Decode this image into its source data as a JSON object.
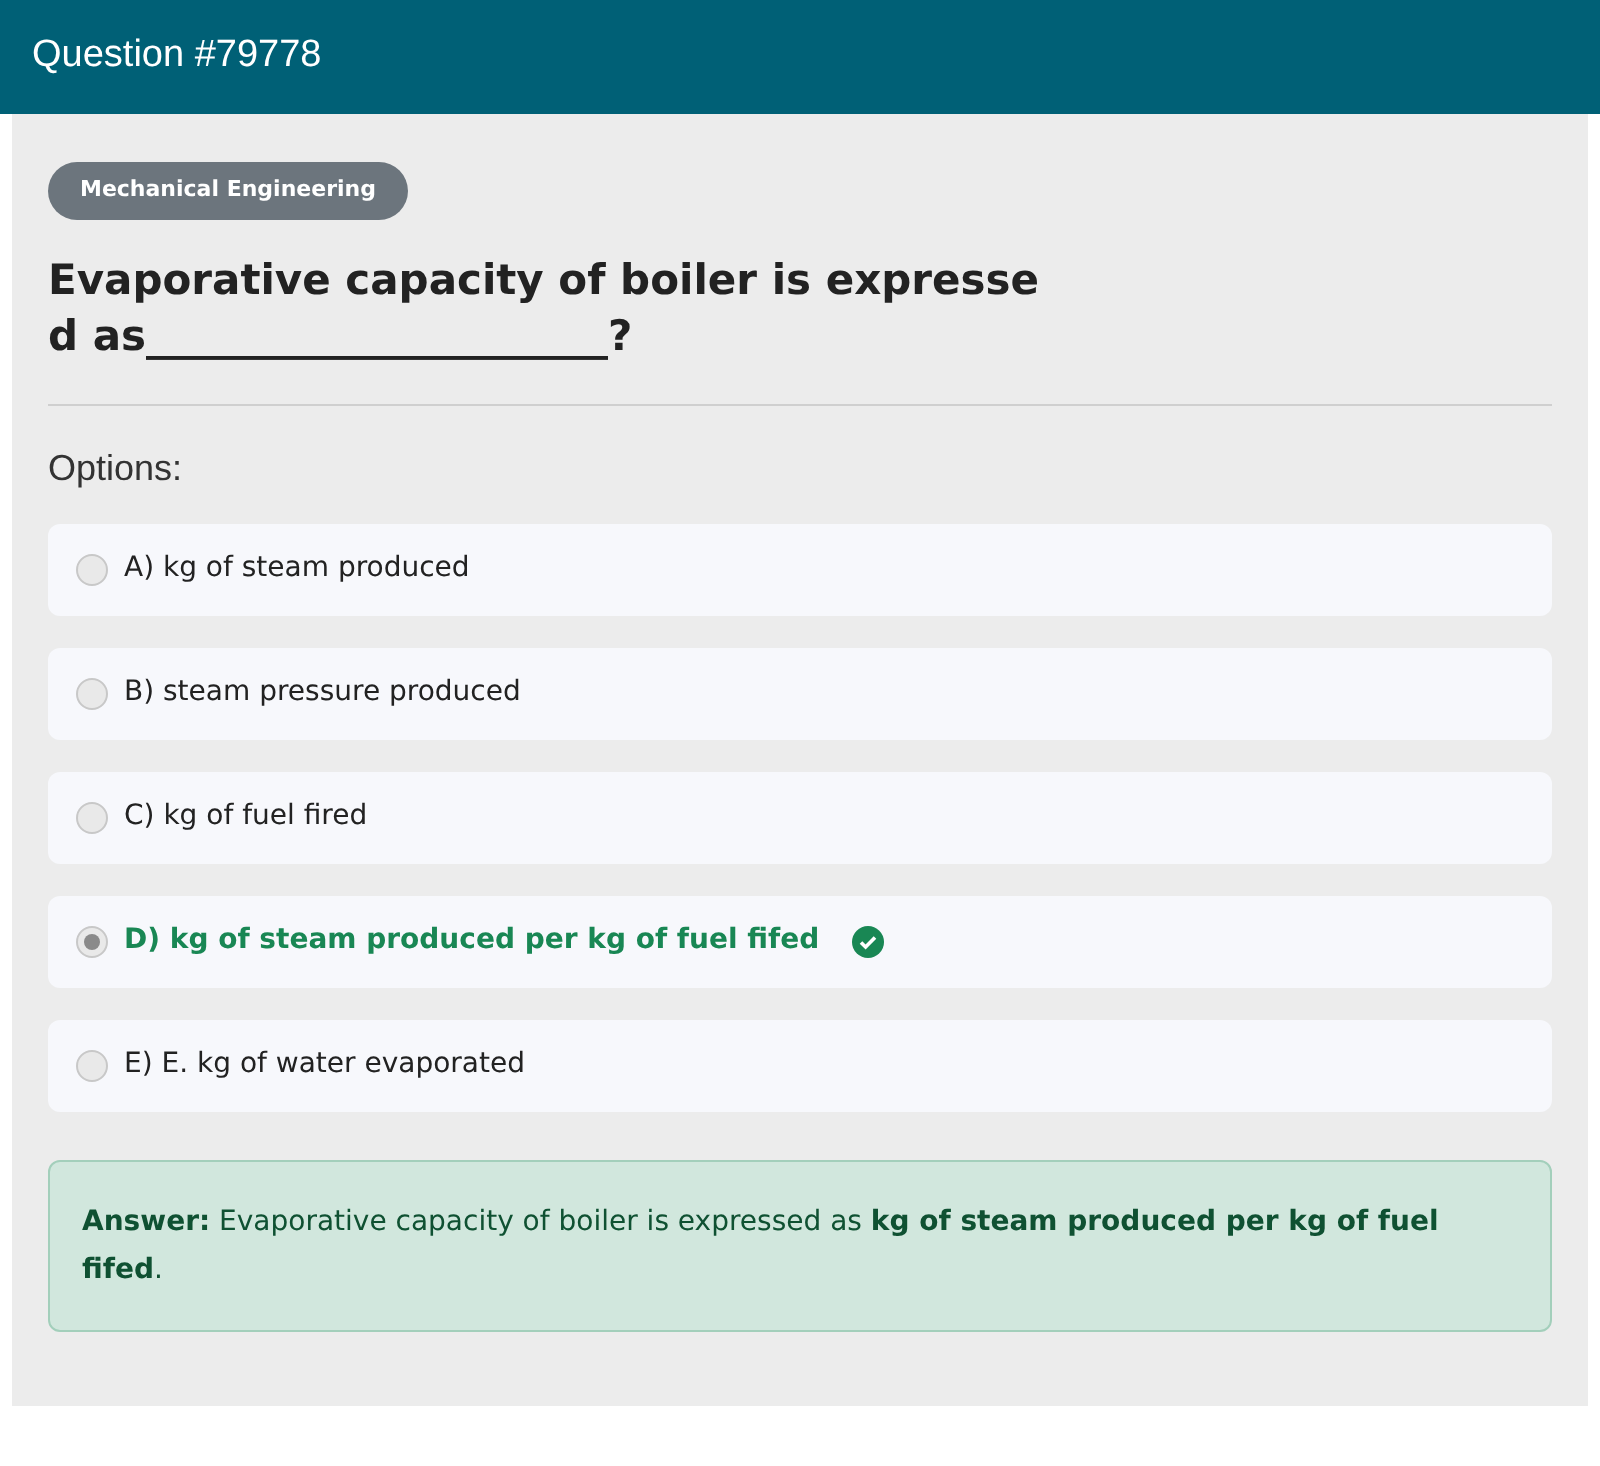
{
  "header": {
    "title": "Question #79778"
  },
  "category": "Mechanical Engineering",
  "question": "Evaporative capacity of boiler is expressed as______________________?",
  "options_heading": "Options:",
  "options": [
    {
      "label": "A) kg of steam produced",
      "selected": false,
      "correct": false
    },
    {
      "label": "B) steam pressure produced",
      "selected": false,
      "correct": false
    },
    {
      "label": "C) kg of fuel fired",
      "selected": false,
      "correct": false
    },
    {
      "label": "D) kg of steam produced per kg of fuel fifed",
      "selected": true,
      "correct": true
    },
    {
      "label": "E) E. kg of water evaporated",
      "selected": false,
      "correct": false
    }
  ],
  "answer": "**Answer:** Evaporative capacity of boiler is expressed as **kg of steam produced per kg of fuel fifed**."
}
